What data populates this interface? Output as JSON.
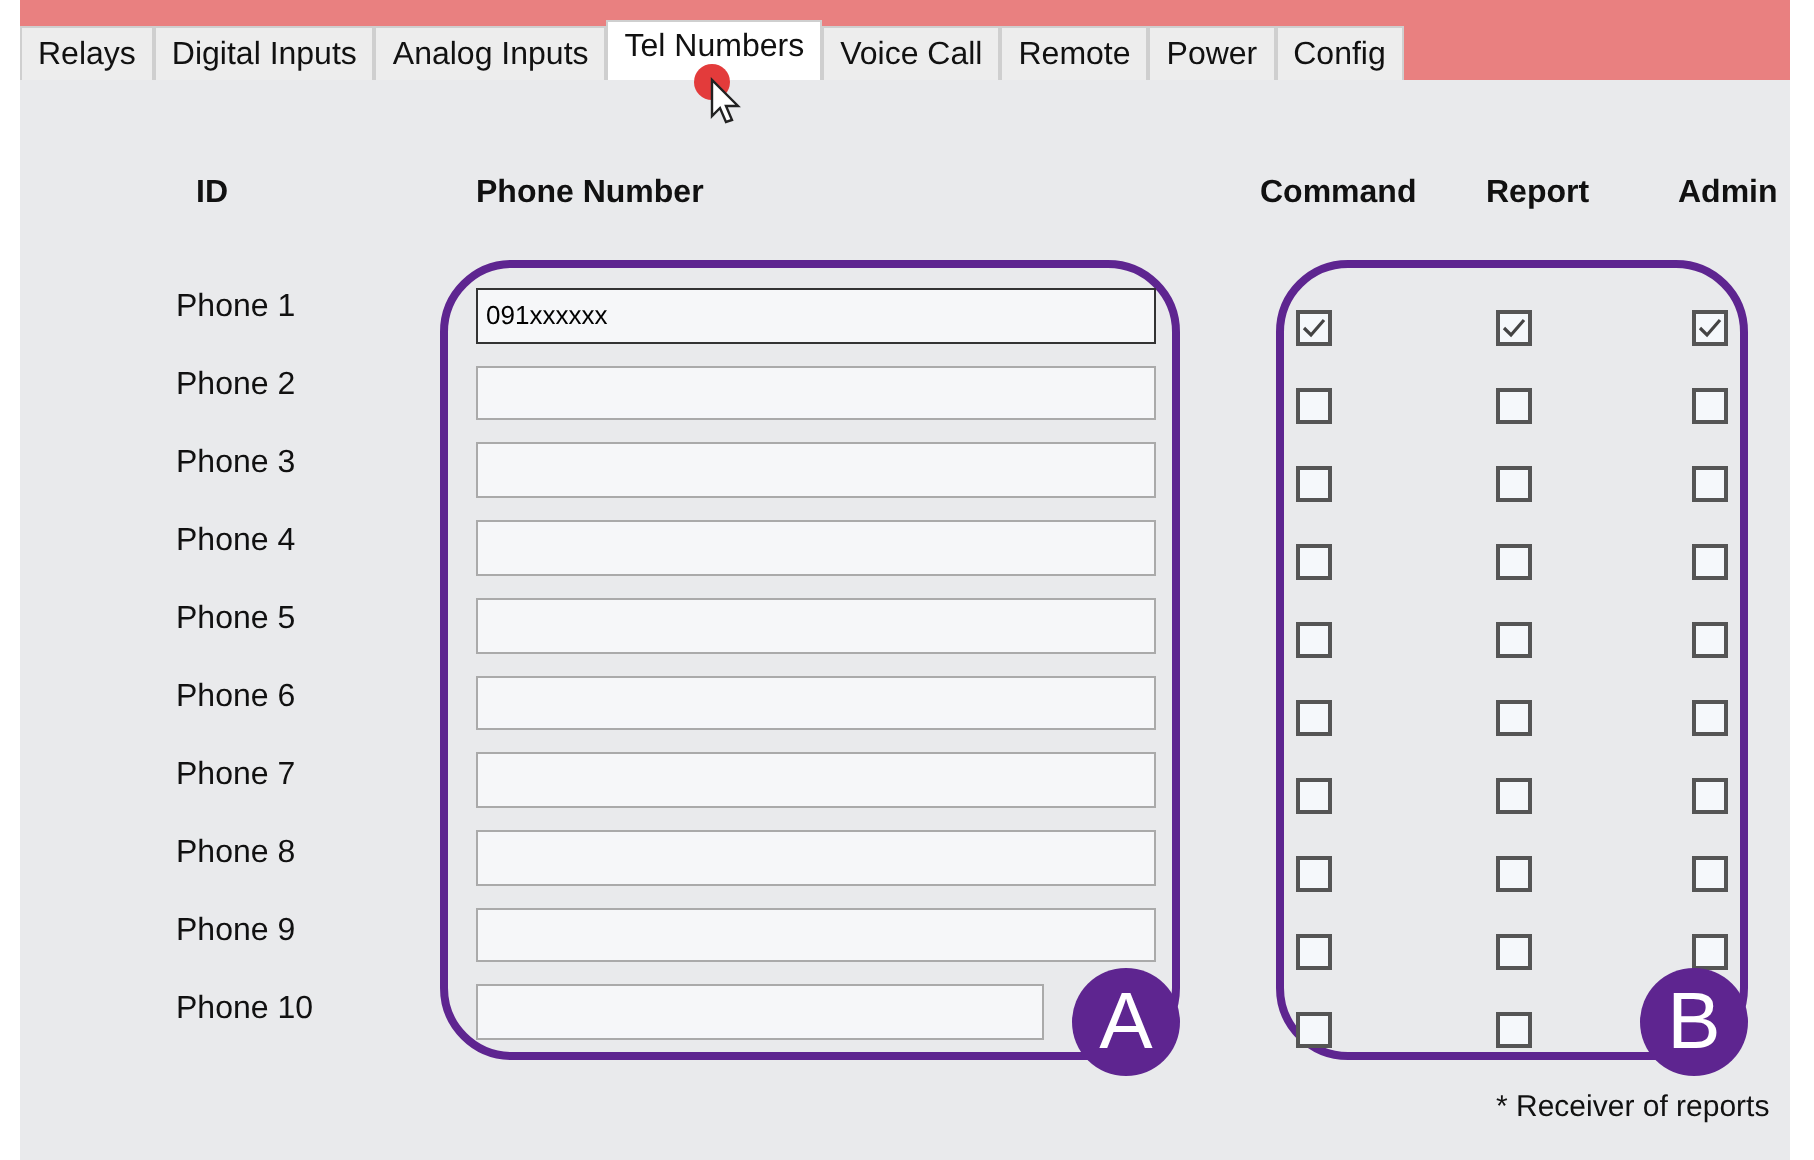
{
  "tabs": [
    {
      "label": "Relays",
      "selected": false
    },
    {
      "label": "Digital Inputs",
      "selected": false
    },
    {
      "label": "Analog Inputs",
      "selected": false
    },
    {
      "label": "Tel Numbers",
      "selected": true
    },
    {
      "label": "Voice Call",
      "selected": false
    },
    {
      "label": "Remote",
      "selected": false
    },
    {
      "label": "Power",
      "selected": false
    },
    {
      "label": "Config",
      "selected": false
    }
  ],
  "columns": {
    "id": "ID",
    "phone": "Phone Number",
    "command": "Command",
    "report": "Report",
    "admin": "Admin"
  },
  "phones": [
    {
      "id": "Phone 1",
      "number": "091xxxxxx",
      "command": true,
      "report": true,
      "admin": true
    },
    {
      "id": "Phone 2",
      "command": false,
      "report": false,
      "admin": false
    },
    {
      "id": "Phone 3",
      "command": false,
      "report": false,
      "admin": false
    },
    {
      "id": "Phone 4",
      "command": false,
      "report": false,
      "admin": false
    },
    {
      "id": "Phone 5",
      "command": false,
      "report": false,
      "admin": false
    },
    {
      "id": "Phone 6",
      "command": false,
      "report": false,
      "admin": false
    },
    {
      "id": "Phone 7",
      "command": false,
      "report": false,
      "admin": false
    },
    {
      "id": "Phone 8",
      "command": false,
      "report": false,
      "admin": false
    },
    {
      "id": "Phone 9",
      "command": false,
      "report": false,
      "admin": false
    },
    {
      "id": "Phone 10",
      "command": false,
      "report": false
    }
  ],
  "badges": [
    "A",
    "B"
  ],
  "footnote": "* Receiver of reports"
}
